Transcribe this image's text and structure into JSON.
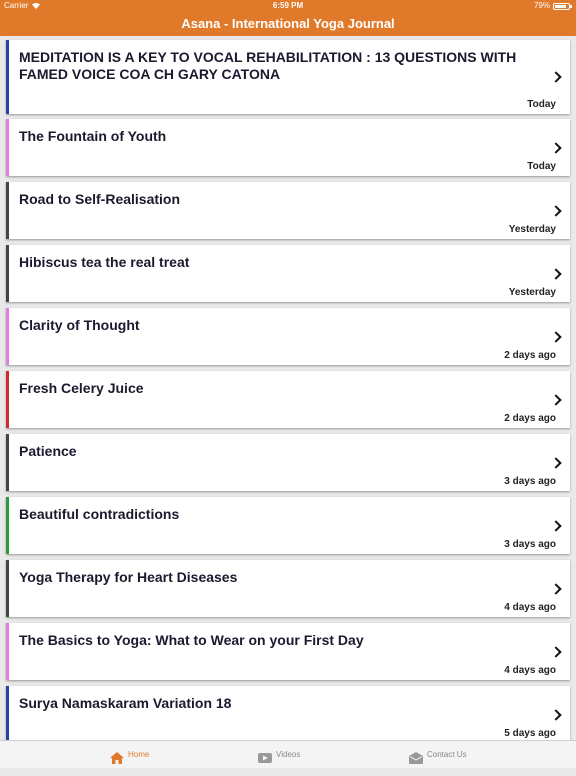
{
  "status_bar": {
    "carrier": "Carrier",
    "time": "6:59 PM",
    "battery": "79%"
  },
  "nav": {
    "title": "Asana - International Yoga Journal"
  },
  "articles": [
    {
      "title": "MEDITATION IS A KEY TO VOCAL REHABILITATION : 13 QUESTIONS WITH FAMED VOICE COA CH GARY CATONA",
      "date": "Today",
      "accent": "#2a3fa8"
    },
    {
      "title": "The Fountain of Youth",
      "date": "Today",
      "accent": "#e07de8"
    },
    {
      "title": "Road to Self-Realisation",
      "date": "Yesterday",
      "accent": "#444444"
    },
    {
      "title": "Hibiscus tea the real treat",
      "date": "Yesterday",
      "accent": "#444444"
    },
    {
      "title": "Clarity of Thought",
      "date": "2 days ago",
      "accent": "#e07de8"
    },
    {
      "title": "Fresh Celery Juice",
      "date": "2 days ago",
      "accent": "#d02a2a"
    },
    {
      "title": "Patience",
      "date": "3 days ago",
      "accent": "#444444"
    },
    {
      "title": "Beautiful contradictions",
      "date": "3 days ago",
      "accent": "#2a9a3a"
    },
    {
      "title": "Yoga Therapy for Heart Diseases",
      "date": "4 days ago",
      "accent": "#444444"
    },
    {
      "title": "The Basics to Yoga: What to Wear on your First Day",
      "date": "4 days ago",
      "accent": "#e07de8"
    },
    {
      "title": "Surya Namaskaram Variation 18",
      "date": "5 days ago",
      "accent": "#2a3fa8"
    }
  ],
  "tabs": [
    {
      "label": "Home",
      "icon": "home-icon",
      "active": true
    },
    {
      "label": "Videos",
      "icon": "video-icon",
      "active": false
    },
    {
      "label": "Contact Us",
      "icon": "mail-icon",
      "active": false
    }
  ],
  "colors": {
    "brand": "#e07a2a"
  }
}
